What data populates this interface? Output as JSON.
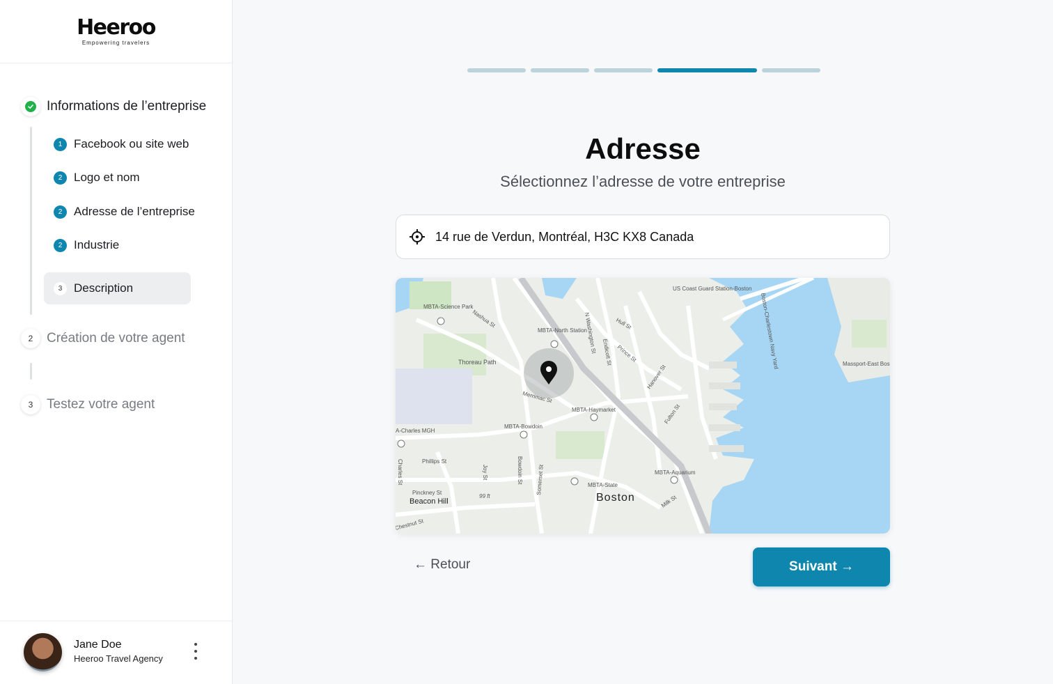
{
  "brand": {
    "name": "Heeroo",
    "tagline": "Empowering travelers"
  },
  "steps": [
    {
      "num": "✓",
      "label": "Informations de l’entreprise",
      "status": "done"
    },
    {
      "num": "2",
      "label": "Création de votre agent",
      "status": "pending"
    },
    {
      "num": "3",
      "label": "Testez votre agent",
      "status": "pending"
    }
  ],
  "substeps": [
    {
      "num": "1",
      "label": "Facebook ou site web"
    },
    {
      "num": "2",
      "label": "Logo et nom"
    },
    {
      "num": "2",
      "label": "Adresse de l’entreprise"
    },
    {
      "num": "2",
      "label": "Industrie"
    },
    {
      "num": "3",
      "label": "Description",
      "active": true
    }
  ],
  "user": {
    "name": "Jane Doe",
    "org": "Heeroo Travel Agency"
  },
  "progress": {
    "total": 5,
    "current": 4
  },
  "page": {
    "title": "Adresse",
    "subtitle": "Sélectionnez l’adresse de votre entreprise",
    "address_value": "14 rue de Verdun, Montréal, H3C KX8 Canada"
  },
  "map": {
    "labels": {
      "city": "Boston",
      "beacon_hill": "Beacon Hill",
      "thoreau": "Thoreau Path",
      "science_park": "MBTA-Science Park",
      "north_station": "MBTA-North Station",
      "haymarket": "MBTA-Haymarket",
      "bowdoin": "MBTA-Bowdoin",
      "state": "MBTA-State",
      "aquarium": "MBTA-Aquarium",
      "charles": "A-Charles MGH",
      "coast_guard": "US Coast Guard Station-Boston",
      "massport": "Massport-East Boston Piers",
      "nashua": "Nashua St",
      "washington": "N Washington St",
      "endicott": "Endicott St",
      "hull": "Hull St",
      "prince": "Prince St",
      "hanover": "Hanover St",
      "fulton": "Fulton St",
      "merrimac": "Merrimac St",
      "phillips": "Phillips St",
      "joy": "Joy St",
      "bowdoin_st": "Bowdoin St",
      "somerset": "Somerset St",
      "pinckney": "Pinckney St",
      "charles_st": "Charles St",
      "chestnut": "Chestnut St",
      "milk": "Milk St",
      "elevation": "99 ft",
      "navy_yard": "Boston-Charlestown Navy Yard"
    }
  },
  "actions": {
    "back": "← Retour",
    "next": "Suivant →"
  },
  "colors": {
    "accent": "#0f86ad",
    "success": "#22b04b"
  }
}
